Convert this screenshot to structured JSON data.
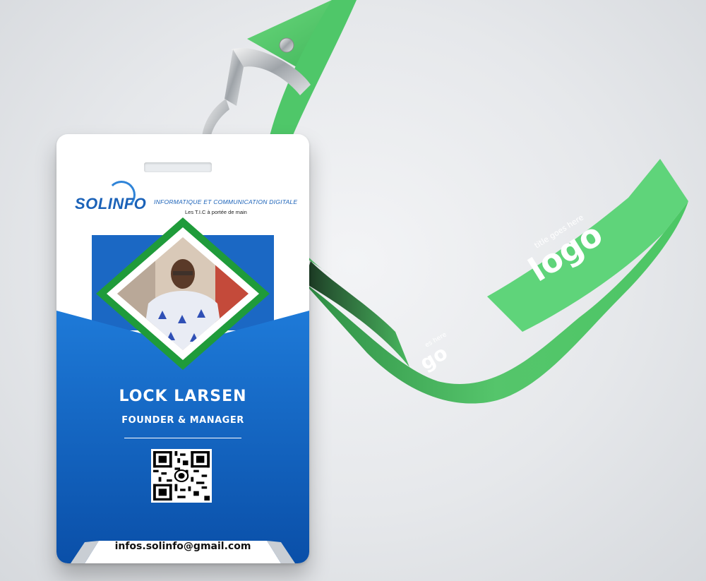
{
  "badge": {
    "brand": "SOLINFO",
    "tagline": "INFORMATIQUE ET COMMUNICATION DIGITALE",
    "subtagline": "Les T.I.C à portée de main",
    "name": "LOCK LARSEN",
    "role": "FOUNDER & MANAGER",
    "email": "infos.solinfo@gmail.com"
  },
  "lanyard": {
    "logo_text": "logo",
    "title_text": "title goes here",
    "logo_text_partial": "go",
    "title_text_partial": "es here"
  },
  "colors": {
    "badge_blue": "#0f5bb5",
    "frame_green": "#1f9b3a",
    "lanyard_green": "#4cc765",
    "brand_blue": "#1b62b8"
  }
}
